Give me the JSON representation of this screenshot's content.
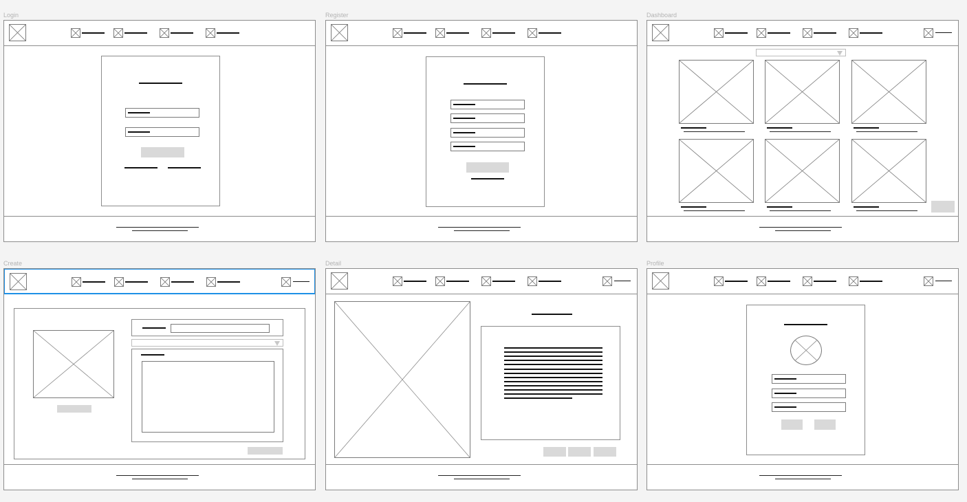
{
  "frames": {
    "login": {
      "label": "Login"
    },
    "register": {
      "label": "Register"
    },
    "dashboard": {
      "label": "Dashboard"
    },
    "create": {
      "label": "Create"
    },
    "detail": {
      "label": "Detail"
    },
    "profile": {
      "label": "Profile"
    }
  },
  "header": {
    "logo_icon": "image-placeholder-icon",
    "nav_icon": "image-placeholder-icon",
    "nav_item_count": 4
  },
  "dashboard": {
    "card_count": 6
  },
  "colors": {
    "canvas": "#f4f4f4",
    "frame_border": "#8c8c8c",
    "selection": "#1e90e6",
    "button_fill": "#d9d9d9",
    "text_placeholder": "#111111",
    "frame_label": "#b3b3b3"
  }
}
